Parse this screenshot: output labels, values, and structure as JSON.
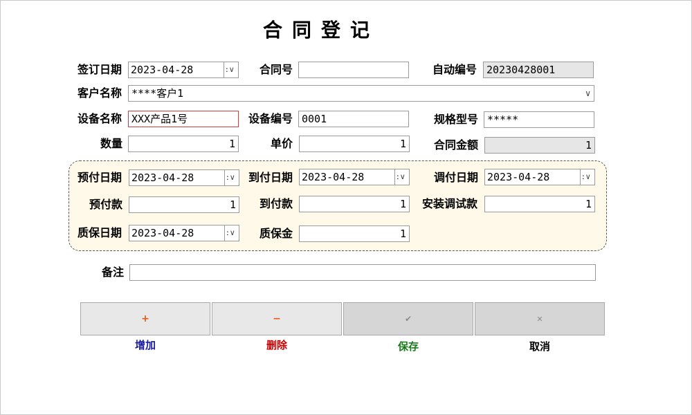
{
  "window": {
    "title": "合同登记"
  },
  "form": {
    "sign_date_label": "签订日期",
    "sign_date": "2023-04-28",
    "contract_no_label": "合同号",
    "contract_no": "",
    "auto_no_label": "自动编号",
    "auto_no": "20230428001",
    "customer_label": "客户名称",
    "customer": "****客户1",
    "device_name_label": "设备名称",
    "device_name": "XXX产品1号",
    "device_no_label": "设备编号",
    "device_no": "0001",
    "spec_label": "规格型号",
    "spec": "*****",
    "qty_label": "数量",
    "qty": "1",
    "unit_price_label": "单价",
    "unit_price": "1",
    "amount_label": "合同金额",
    "amount": "1"
  },
  "payments": {
    "prepay_date_label": "预付日期",
    "prepay_date": "2023-04-28",
    "arrival_date_label": "到付日期",
    "arrival_date": "2023-04-28",
    "commission_date_label": "调付日期",
    "commission_date": "2023-04-28",
    "prepay_label": "预付款",
    "prepay": "1",
    "arrival_pay_label": "到付款",
    "arrival_pay": "1",
    "install_pay_label": "安装调试款",
    "install_pay": "1",
    "warranty_date_label": "质保日期",
    "warranty_date": "2023-04-28",
    "warranty_deposit_label": "质保金",
    "warranty_deposit": "1"
  },
  "remarks": {
    "label": "备注",
    "value": ""
  },
  "actions": {
    "add": {
      "icon": "+",
      "label": "增加",
      "color": "#e05a1a",
      "label_color": "#1a1aa0"
    },
    "delete": {
      "icon": "−",
      "label": "删除",
      "color": "#e05a1a",
      "label_color": "#d00000"
    },
    "save": {
      "icon": "✔",
      "label": "保存",
      "color": "#8a8a8a",
      "label_color": "#1a7a1a"
    },
    "cancel": {
      "icon": "✕",
      "label": "取消",
      "color": "#8a8a8a",
      "label_color": "#000000"
    }
  },
  "dropdown_glyph": "∨",
  "spin_colon": ":"
}
